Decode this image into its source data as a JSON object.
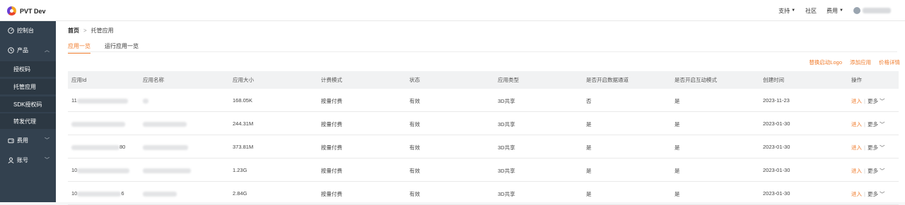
{
  "app": {
    "title": "PVT Dev"
  },
  "topnav": {
    "support": "支持",
    "community": "社区",
    "billing": "费用"
  },
  "sidebar": {
    "items": [
      {
        "label": "控制台",
        "icon": "dashboard-icon"
      },
      {
        "label": "产品",
        "icon": "clock-icon"
      },
      {
        "label": "授权码"
      },
      {
        "label": "托管应用"
      },
      {
        "label": "SDK授权码"
      },
      {
        "label": "转发代理"
      },
      {
        "label": "费用",
        "icon": "wallet-icon"
      },
      {
        "label": "账号",
        "icon": "user-icon"
      }
    ]
  },
  "breadcrumb": {
    "home": "首页",
    "current": "托管应用"
  },
  "tabs": [
    "应用一览",
    "运行应用一览"
  ],
  "actions": {
    "replace_logo": "替换启动Logo",
    "add_app": "添加应用",
    "price_details": "价格详情"
  },
  "table": {
    "headers": [
      "应用Id",
      "应用名称",
      "应用大小",
      "计费模式",
      "状态",
      "应用类型",
      "是否开启数据通道",
      "是否开启互动模式",
      "创建时间",
      "操作"
    ],
    "rows": [
      {
        "id_prefix": "11",
        "id_suffix": "",
        "size": "168.05K",
        "billing": "按量付费",
        "status": "有效",
        "type": "3D共享",
        "data_channel": "否",
        "interactive": "是",
        "created": "2023-11-23"
      },
      {
        "id_prefix": "",
        "id_suffix": "",
        "size": "244.31M",
        "billing": "按量付费",
        "status": "有效",
        "type": "3D共享",
        "data_channel": "是",
        "interactive": "是",
        "created": "2023-01-30"
      },
      {
        "id_prefix": "",
        "id_suffix": "80",
        "size": "373.81M",
        "billing": "按量付费",
        "status": "有效",
        "type": "3D共享",
        "data_channel": "是",
        "interactive": "是",
        "created": "2023-01-30"
      },
      {
        "id_prefix": "10",
        "id_suffix": "",
        "size": "1.23G",
        "billing": "按量付费",
        "status": "有效",
        "type": "3D共享",
        "data_channel": "是",
        "interactive": "是",
        "created": "2023-01-30"
      },
      {
        "id_prefix": "10",
        "id_suffix": "6",
        "size": "2.84G",
        "billing": "按量付费",
        "status": "有效",
        "type": "3D共享",
        "data_channel": "是",
        "interactive": "是",
        "created": "2023-01-30"
      }
    ],
    "op_enter": "进入",
    "op_more": "更多"
  },
  "colors": {
    "accent": "#f07b2b",
    "sidebar_bg": "#33414f"
  }
}
